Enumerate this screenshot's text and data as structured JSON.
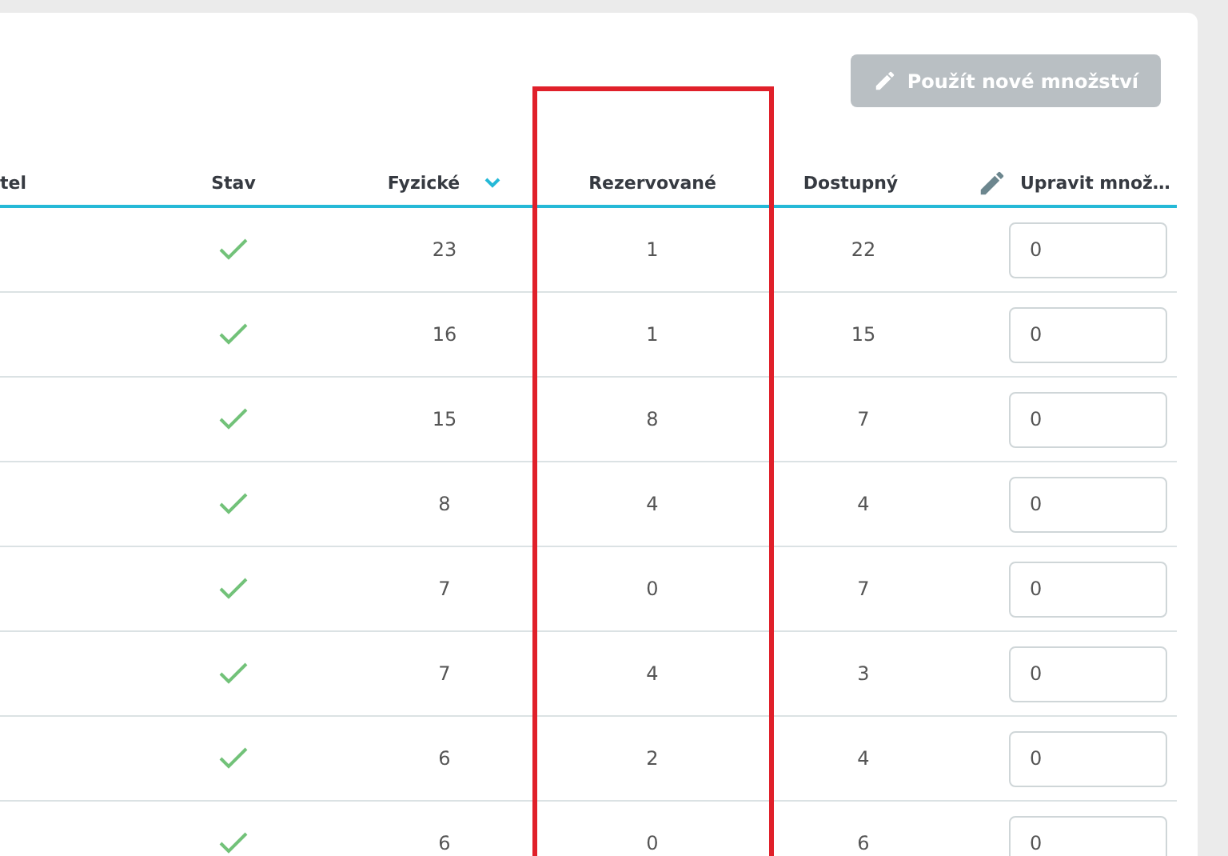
{
  "apply_button": {
    "label": "Použít nové množství",
    "disabled": true
  },
  "table": {
    "columns": [
      {
        "label": "tel"
      },
      {
        "label": "Stav"
      },
      {
        "label": "Fyzické",
        "sorted": true
      },
      {
        "label": "Rezervované",
        "highlighted": true,
        "color": "#e0202a"
      },
      {
        "label": "Dostupný"
      },
      {
        "label": "Upravit množ…",
        "editable": true
      }
    ],
    "rows": [
      {
        "in_stock": true,
        "physical": "23",
        "reserved": "1",
        "available": "22",
        "edit_value": "0"
      },
      {
        "in_stock": true,
        "physical": "16",
        "reserved": "1",
        "available": "15",
        "edit_value": "0"
      },
      {
        "in_stock": true,
        "physical": "15",
        "reserved": "8",
        "available": "7",
        "edit_value": "0"
      },
      {
        "in_stock": true,
        "physical": "8",
        "reserved": "4",
        "available": "4",
        "edit_value": "0"
      },
      {
        "in_stock": true,
        "physical": "7",
        "reserved": "0",
        "available": "7",
        "edit_value": "0"
      },
      {
        "in_stock": true,
        "physical": "7",
        "reserved": "4",
        "available": "3",
        "edit_value": "0"
      },
      {
        "in_stock": true,
        "physical": "6",
        "reserved": "2",
        "available": "4",
        "edit_value": "0"
      },
      {
        "in_stock": true,
        "physical": "6",
        "reserved": "0",
        "available": "6",
        "edit_value": "0"
      }
    ]
  }
}
